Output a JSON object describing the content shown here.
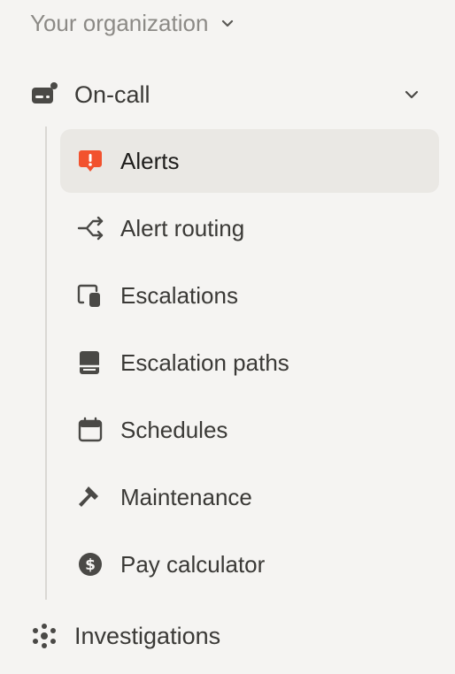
{
  "org": {
    "label": "Your organization"
  },
  "section": {
    "label": "On-call"
  },
  "nav": {
    "items": [
      {
        "label": "Alerts"
      },
      {
        "label": "Alert routing"
      },
      {
        "label": "Escalations"
      },
      {
        "label": "Escalation paths"
      },
      {
        "label": "Schedules"
      },
      {
        "label": "Maintenance"
      },
      {
        "label": "Pay calculator"
      }
    ]
  },
  "bottom": {
    "label": "Investigations"
  },
  "colors": {
    "background": "#f5f4f2",
    "active_bg": "#eae8e4",
    "alert_accent": "#f2522e",
    "text": "#3a3936",
    "muted": "#8c8a86"
  }
}
